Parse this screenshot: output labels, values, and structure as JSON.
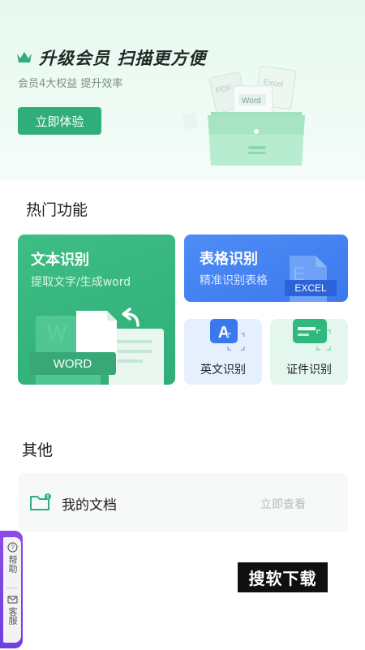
{
  "banner": {
    "title": "升级会员 扫描更方便",
    "subtitle": "会员4大权益 提升效率",
    "cta_label": "立即体验",
    "illustration_labels": {
      "pdf": "PDF",
      "excel": "Excel",
      "word": "Word"
    },
    "accent": "#2fae7a"
  },
  "hot_features": {
    "title": "热门功能",
    "text_recognition": {
      "title": "文本识别",
      "subtitle": "提取文字/生成word",
      "tag": "WORD",
      "tag_bg_letter": "W"
    },
    "table_recognition": {
      "title": "表格识别",
      "subtitle": "精准识别表格",
      "tag": "EXCEL",
      "tag_bg_letter": "E"
    },
    "english_recognition": {
      "label": "英文识别",
      "icon_letter": "A"
    },
    "id_recognition": {
      "label": "证件识别"
    }
  },
  "others": {
    "title": "其他",
    "my_docs": {
      "label": "我的文档",
      "action": "立即查看"
    }
  },
  "help_widget": {
    "help_label": "帮助",
    "service_label": "客服"
  },
  "watermark": "搜软下载",
  "colors": {
    "green": "#2fae78",
    "blue": "#3b78ee",
    "purple": "#7a43e3"
  },
  "icons": [
    "crown-icon",
    "folder-icon",
    "help-icon",
    "mail-icon",
    "undo-arrow-icon",
    "scan-frame-icon",
    "id-card-icon"
  ]
}
